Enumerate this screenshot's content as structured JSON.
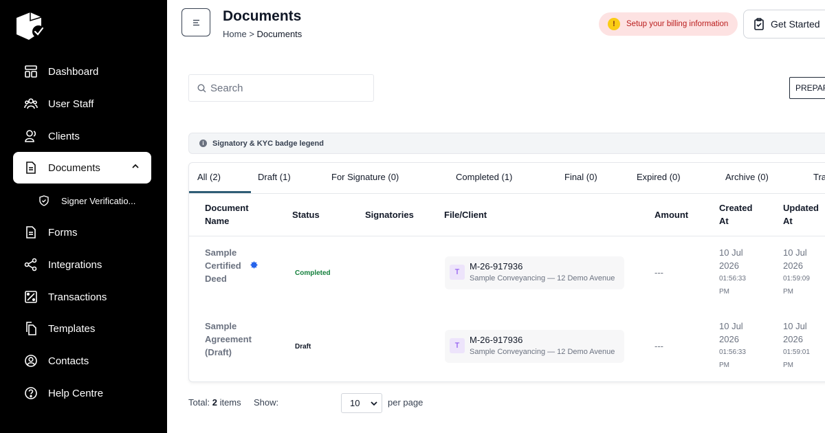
{
  "sidebar": {
    "items": [
      {
        "label": "Dashboard",
        "icon": "dashboard-icon"
      },
      {
        "label": "User Staff",
        "icon": "users-icon"
      },
      {
        "label": "Clients",
        "icon": "clients-icon"
      },
      {
        "label": "Documents",
        "icon": "document-icon"
      },
      {
        "label": "Forms",
        "icon": "form-icon"
      },
      {
        "label": "Integrations",
        "icon": "integrations-icon"
      },
      {
        "label": "Transactions",
        "icon": "transactions-icon"
      },
      {
        "label": "Templates",
        "icon": "templates-icon"
      },
      {
        "label": "Contacts",
        "icon": "contacts-icon"
      },
      {
        "label": "Help Centre",
        "icon": "help-icon"
      }
    ],
    "sub_item": {
      "label": "Signer Verificatio...",
      "icon": "shield-icon"
    }
  },
  "header": {
    "title": "Documents",
    "breadcrumb_home": "Home",
    "breadcrumb_sep": ">",
    "breadcrumb_current": "Documents",
    "billing_text": "Setup your billing information",
    "billing_icon_text": "!",
    "get_started": "Get Started"
  },
  "toolbar": {
    "search_placeholder": "Search",
    "prepare_label": "PREPAR"
  },
  "legend_text": "Signatory & KYC badge legend",
  "tabs": [
    "All (2)",
    "Draft (1)",
    "For Signature (0)",
    "Completed (1)",
    "Final (0)",
    "Expired (0)",
    "Archive (0)",
    "Tra"
  ],
  "table": {
    "headers": {
      "name_1": "Document",
      "name_2": "Name",
      "status": "Status",
      "signatories": "Signatories",
      "file_client": "File/Client",
      "amount": "Amount",
      "created_1": "Created",
      "created_2": "At",
      "updated_1": "Updated",
      "updated_2": "At"
    },
    "rows": [
      {
        "name_lines": [
          "Sample",
          "Certified",
          "Deed"
        ],
        "status": "Completed",
        "file_avatar": "T",
        "file_code": "M-26-917936",
        "client": "Sample Conveyancing — 12 Demo Avenue",
        "amount": "---",
        "created": {
          "date1": "10 Jul",
          "date2": "2026",
          "time1": "01:56:33",
          "time2": "PM"
        },
        "updated": {
          "date1": "10 Jul",
          "date2": "2026",
          "time1": "01:59:09",
          "time2": "PM"
        }
      },
      {
        "name_lines": [
          "Sample",
          "Agreement",
          "(Draft)"
        ],
        "status": "Draft",
        "file_avatar": "T",
        "file_code": "M-26-917936",
        "client": "Sample Conveyancing — 12 Demo Avenue",
        "amount": "---",
        "created": {
          "date1": "10 Jul",
          "date2": "2026",
          "time1": "01:56:33",
          "time2": "PM"
        },
        "updated": {
          "date1": "10 Jul",
          "date2": "2026",
          "time1": "01:59:01",
          "time2": "PM"
        }
      }
    ]
  },
  "footer": {
    "total_label": "Total:",
    "total_count": "2",
    "total_unit": "items",
    "show_label": "Show:",
    "per_page_value": "10",
    "per_page_label": "per page"
  },
  "colors": {
    "sidebar_bg": "#000000",
    "accent_tab": "#2f5d75",
    "billing_bg": "#fde2e2",
    "billing_text": "#b91c1c",
    "status_completed": "#15803d"
  }
}
